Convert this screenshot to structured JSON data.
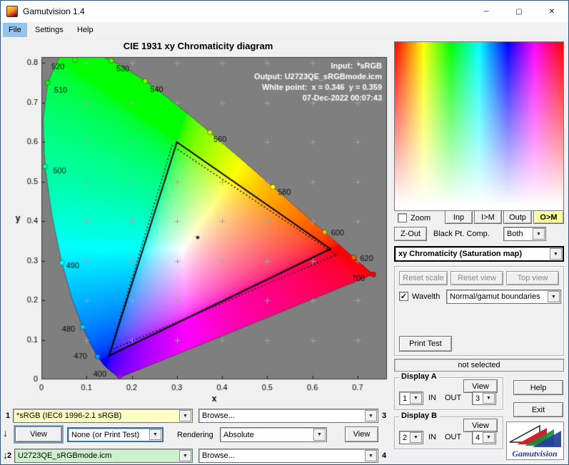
{
  "icons": {
    "minimize": "─",
    "maximize": "▢",
    "close": "✕",
    "dropdown": "▼",
    "check": "✓",
    "flow_arrow": "↓"
  },
  "titlebar": {
    "title": "Gamutvision 1.4"
  },
  "menu": {
    "file": "File",
    "settings": "Settings",
    "help": "Help"
  },
  "colors": {
    "plot_bg": "#7f7f7f",
    "profile1_bg": "#ffffc4",
    "profile2_bg": "#ccf2cc",
    "om_button_bg": "#ffff96",
    "menu_highlight": "#94c4ec"
  },
  "chart_data": {
    "type": "chromaticity",
    "title": "CIE 1931 xy Chromaticity diagram",
    "xlabel": "x",
    "ylabel": "y",
    "xlim": [
      0,
      0.765
    ],
    "ylim": [
      0,
      0.815
    ],
    "xticks": [
      "0",
      "0.1",
      "0.2",
      "0.3",
      "0.4",
      "0.5",
      "0.6",
      "0.7"
    ],
    "yticks": [
      "0",
      "0.1",
      "0.2",
      "0.3",
      "0.4",
      "0.5",
      "0.6",
      "0.7",
      "0.8"
    ],
    "grid_step": 0.1,
    "plot_bg": "#7f7f7f",
    "annotations": [
      "Input:  *sRGB",
      "Output: U2723QE_sRGBmode.icm",
      "White point:  x = 0.346  y = 0.359",
      "07-Dec-2022 00:07:43"
    ],
    "white_point": [
      0.346,
      0.359
    ],
    "input_gamut_triangle": [
      [
        0.64,
        0.33
      ],
      [
        0.3,
        0.6
      ],
      [
        0.15,
        0.06
      ]
    ],
    "output_gamut_triangle": [
      [
        0.653,
        0.315
      ],
      [
        0.289,
        0.591
      ],
      [
        0.153,
        0.074
      ]
    ],
    "spectral_locus": [
      [
        380,
        0.1741,
        0.005
      ],
      [
        390,
        0.1738,
        0.0049
      ],
      [
        400,
        0.1733,
        0.0048
      ],
      [
        410,
        0.1726,
        0.0048
      ],
      [
        420,
        0.1714,
        0.0051
      ],
      [
        430,
        0.1689,
        0.0069
      ],
      [
        440,
        0.1644,
        0.0109
      ],
      [
        450,
        0.1566,
        0.0177
      ],
      [
        460,
        0.144,
        0.0297
      ],
      [
        465,
        0.1355,
        0.0399
      ],
      [
        470,
        0.1241,
        0.0578
      ],
      [
        475,
        0.1096,
        0.0868
      ],
      [
        480,
        0.0913,
        0.1327
      ],
      [
        485,
        0.0687,
        0.2007
      ],
      [
        490,
        0.0454,
        0.295
      ],
      [
        495,
        0.0235,
        0.4127
      ],
      [
        500,
        0.0082,
        0.5384
      ],
      [
        505,
        0.0039,
        0.6548
      ],
      [
        510,
        0.0139,
        0.7502
      ],
      [
        515,
        0.0389,
        0.812
      ],
      [
        520,
        0.0743,
        0.8338
      ],
      [
        525,
        0.1142,
        0.8262
      ],
      [
        530,
        0.1547,
        0.8059
      ],
      [
        535,
        0.1929,
        0.7816
      ],
      [
        540,
        0.2296,
        0.7543
      ],
      [
        545,
        0.2658,
        0.7243
      ],
      [
        550,
        0.3016,
        0.6923
      ],
      [
        555,
        0.3373,
        0.6589
      ],
      [
        560,
        0.3731,
        0.6245
      ],
      [
        565,
        0.4087,
        0.5896
      ],
      [
        570,
        0.4441,
        0.5547
      ],
      [
        575,
        0.4788,
        0.5202
      ],
      [
        580,
        0.5125,
        0.4866
      ],
      [
        585,
        0.5448,
        0.4544
      ],
      [
        590,
        0.5752,
        0.4242
      ],
      [
        595,
        0.6029,
        0.3965
      ],
      [
        600,
        0.627,
        0.3725
      ],
      [
        605,
        0.6482,
        0.3514
      ],
      [
        610,
        0.6658,
        0.334
      ],
      [
        615,
        0.6801,
        0.3197
      ],
      [
        620,
        0.6915,
        0.3083
      ],
      [
        630,
        0.7079,
        0.292
      ],
      [
        640,
        0.719,
        0.2809
      ],
      [
        650,
        0.726,
        0.274
      ],
      [
        660,
        0.73,
        0.27
      ],
      [
        680,
        0.7334,
        0.2666
      ],
      [
        700,
        0.7347,
        0.2653
      ]
    ],
    "wavelength_labels": [
      {
        "nm": 400,
        "dx": -37,
        "dy": -2
      },
      {
        "nm": 470,
        "dx": -33,
        "dy": 0
      },
      {
        "nm": 480,
        "dx": -29,
        "dy": 4
      },
      {
        "nm": 490,
        "dx": 6,
        "dy": 5
      },
      {
        "nm": 500,
        "dx": 11,
        "dy": 7
      },
      {
        "nm": 510,
        "dx": 9,
        "dy": 11
      },
      {
        "nm": 520,
        "dx": -33,
        "dy": 10
      },
      {
        "nm": 530,
        "dx": 7,
        "dy": 12
      },
      {
        "nm": 540,
        "dx": 7,
        "dy": 12
      },
      {
        "nm": 560,
        "dx": 5,
        "dy": 10
      },
      {
        "nm": 580,
        "dx": 7,
        "dy": 8
      },
      {
        "nm": 600,
        "dx": 9,
        "dy": 2
      },
      {
        "nm": 620,
        "dx": 9,
        "dy": 2
      },
      {
        "nm": 700,
        "dx": -30,
        "dy": 6
      }
    ]
  },
  "side_panel": {
    "zoom_label": "Zoom",
    "inp": "Inp",
    "i_m": "I>M",
    "outp": "Outp",
    "o_m": "O>M",
    "z_out": "Z-Out",
    "black_pt_label": "Black Pt. Comp.",
    "black_pt_value": "Both",
    "view_mode_value": "xy Chromaticity (Saturation map)",
    "reset_scale": "Reset scale",
    "reset_view": "Reset view",
    "top_view": "Top view",
    "wavelth_label": "Wavelth",
    "wavelth_value": "Normal/gamut boundaries",
    "print_test": "Print Test",
    "status_text": "not selected",
    "display_a_label": "Display A",
    "display_b_label": "Display B",
    "view_label": "View",
    "in_label": "IN",
    "out_label": "OUT",
    "display_a_in": "1",
    "display_a_out": "3",
    "display_b_in": "2",
    "display_b_out": "4",
    "help": "Help",
    "exit": "Exit",
    "logo_text": "Gamutvision"
  },
  "bottom_panel": {
    "row1_num": "1",
    "row1_profile": "*sRGB   (IEC6 1996-2.1 sRGB)",
    "row1_browse": "Browse...",
    "row1_out": "3",
    "view_left": "View",
    "intent_value": "None (or Print Test)",
    "rendering_label": "Rendering",
    "rendering_value": "Absolute",
    "view_right": "View",
    "row2_num": "2",
    "row2_profile": "U2723QE_sRGBmode.icm",
    "row2_browse": "Browse...",
    "row2_out": "4"
  }
}
